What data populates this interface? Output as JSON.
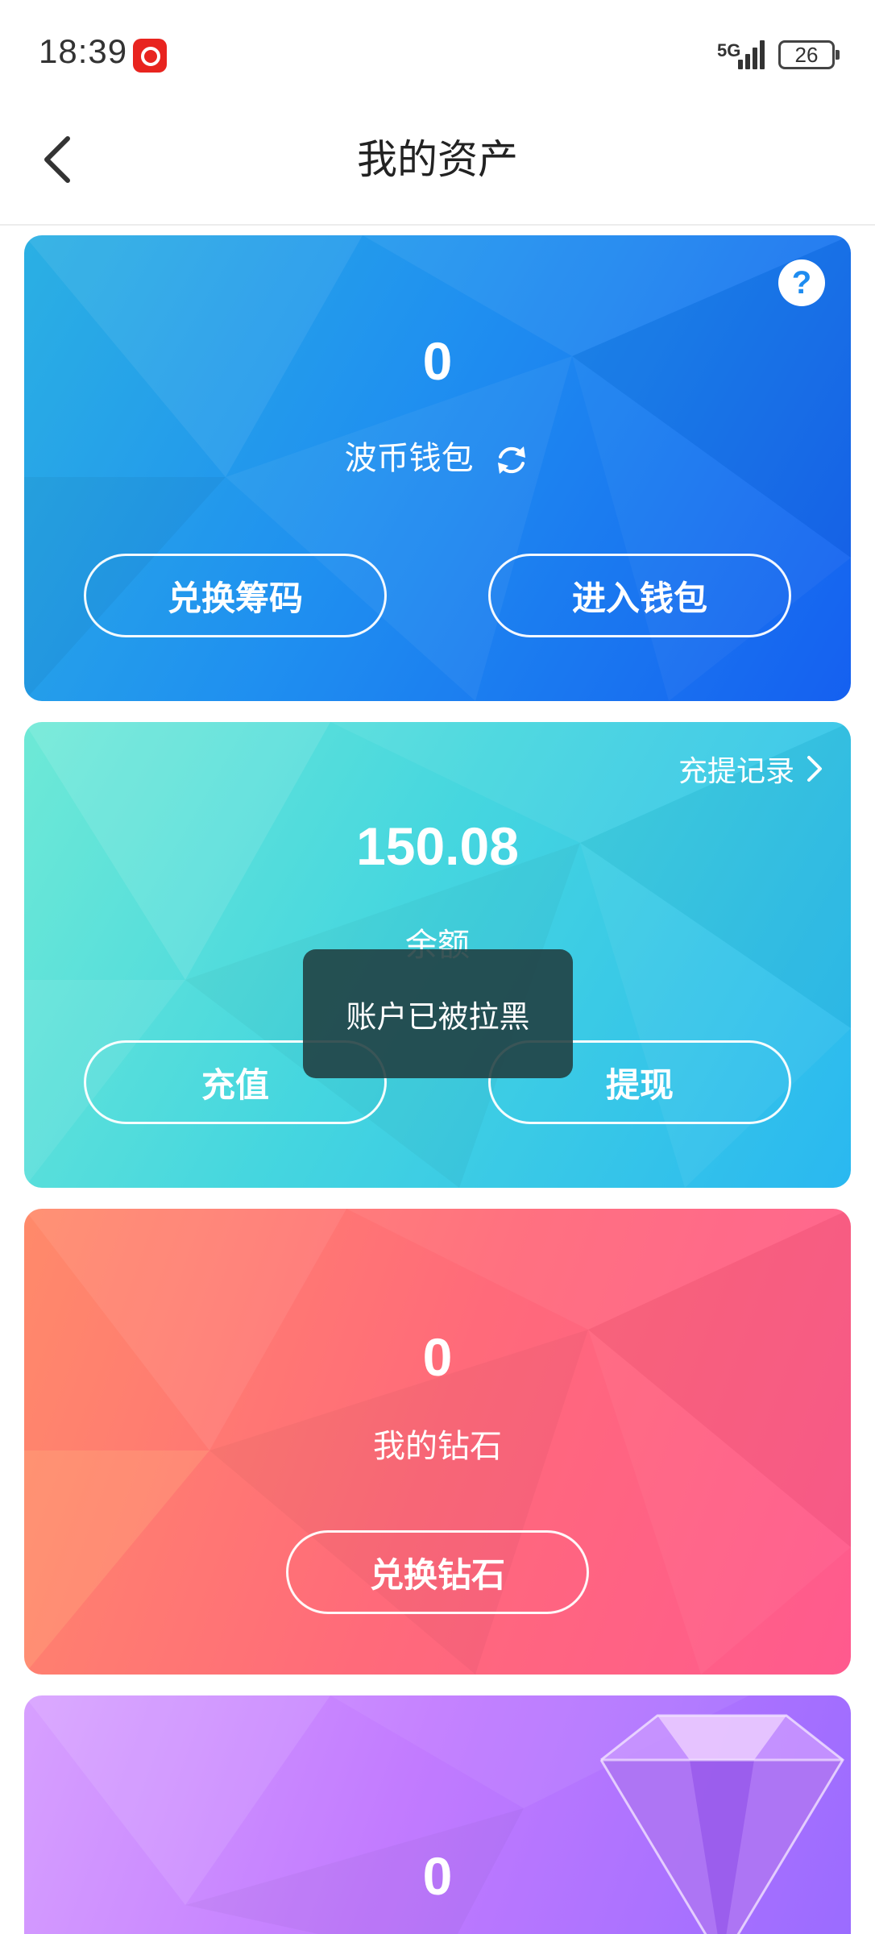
{
  "status_bar": {
    "time": "18:39",
    "network": "5G",
    "battery": "26"
  },
  "header": {
    "title": "我的资产"
  },
  "wallet_card": {
    "value": "0",
    "label": "波币钱包",
    "buttons": [
      "兑换筹码",
      "进入钱包"
    ]
  },
  "balance_card": {
    "value": "150.08",
    "label": "余额",
    "records_link": "充提记录",
    "buttons": [
      "充值",
      "提现"
    ]
  },
  "diamond_card": {
    "value": "0",
    "label": "我的钻石",
    "button": "兑换钻石"
  },
  "gem_card": {
    "value": "0"
  },
  "toast": {
    "message": "账户已被拉黑"
  },
  "colors": {
    "wallet_card": "#1f8ff0",
    "balance_card": "#45d6df",
    "diamond_card": "#ff6a7a",
    "gem_card": "#c27bff"
  },
  "icons": [
    "back-arrow-icon",
    "help-icon",
    "refresh-icon",
    "chevron-right-icon",
    "gem-icon"
  ]
}
